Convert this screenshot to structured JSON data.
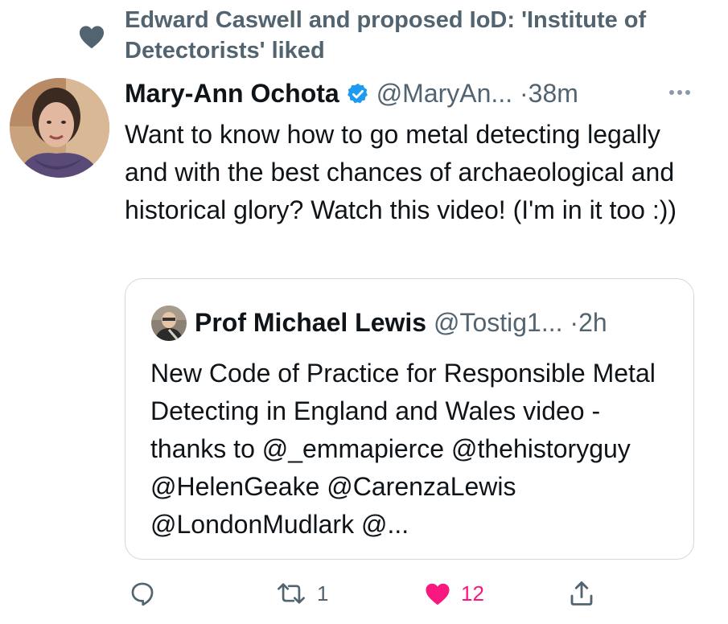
{
  "social_context": {
    "text": "Edward Caswell and proposed IoD: 'Institute of Detectorists' liked",
    "icon": "heart-icon"
  },
  "tweet": {
    "author_name": "Mary-Ann Ochota",
    "author_handle": "@MaryAn...",
    "dot": "·",
    "time": "38m",
    "verified": true,
    "text": "Want to know how to go metal detecting legally and with the best chances of archaeological and historical glory? Watch this video! (I'm in it too :))"
  },
  "quote": {
    "author_name": "Prof Michael Lewis",
    "author_handle": "@Tostig1...",
    "dot": "·",
    "time": "2h",
    "text": "New Code of Practice for Responsible Metal Detecting in England and Wales video - thanks to @_emmapierce @thehistoryguy @HelenGeake @CarenzaLewis @LondonMudlark @..."
  },
  "actions": {
    "reply_count": "",
    "retweet_count": "1",
    "like_count": "12",
    "liked": true
  },
  "colors": {
    "text_primary": "#0f1419",
    "text_secondary": "#536471",
    "verified_blue": "#1d9bf0",
    "like_pink": "#f91880",
    "border": "#cfd9de"
  }
}
